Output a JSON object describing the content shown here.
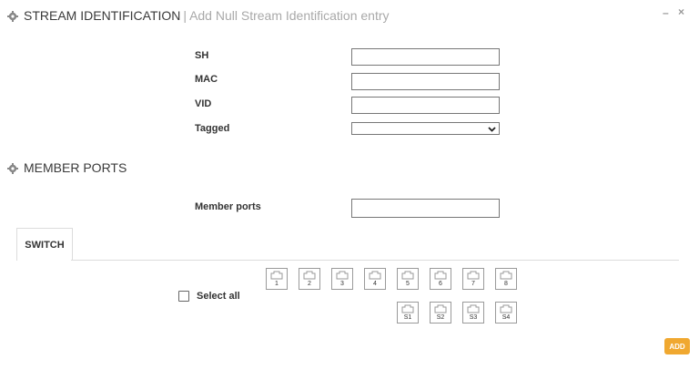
{
  "header": {
    "title": "STREAM IDENTIFICATION",
    "separator": "|",
    "subtitle": "Add Null Stream Identification entry",
    "minimize": "–",
    "close": "×"
  },
  "form": {
    "fields": [
      {
        "label": "SH",
        "value": ""
      },
      {
        "label": "MAC",
        "value": ""
      },
      {
        "label": "VID",
        "value": ""
      }
    ],
    "tagged": {
      "label": "Tagged",
      "value": ""
    }
  },
  "member_ports_section": {
    "title": "MEMBER PORTS",
    "label": "Member ports",
    "value": ""
  },
  "tabs": [
    {
      "label": "SWITCH",
      "active": true
    }
  ],
  "switch_panel": {
    "select_all_label": "Select all",
    "ports_row1": [
      "1",
      "2",
      "3",
      "4",
      "5",
      "6",
      "7",
      "8"
    ],
    "ports_row2": [
      "S1",
      "S2",
      "S3",
      "S4"
    ]
  },
  "add_button": "ADD",
  "colors": {
    "accent": "#f0a830"
  }
}
